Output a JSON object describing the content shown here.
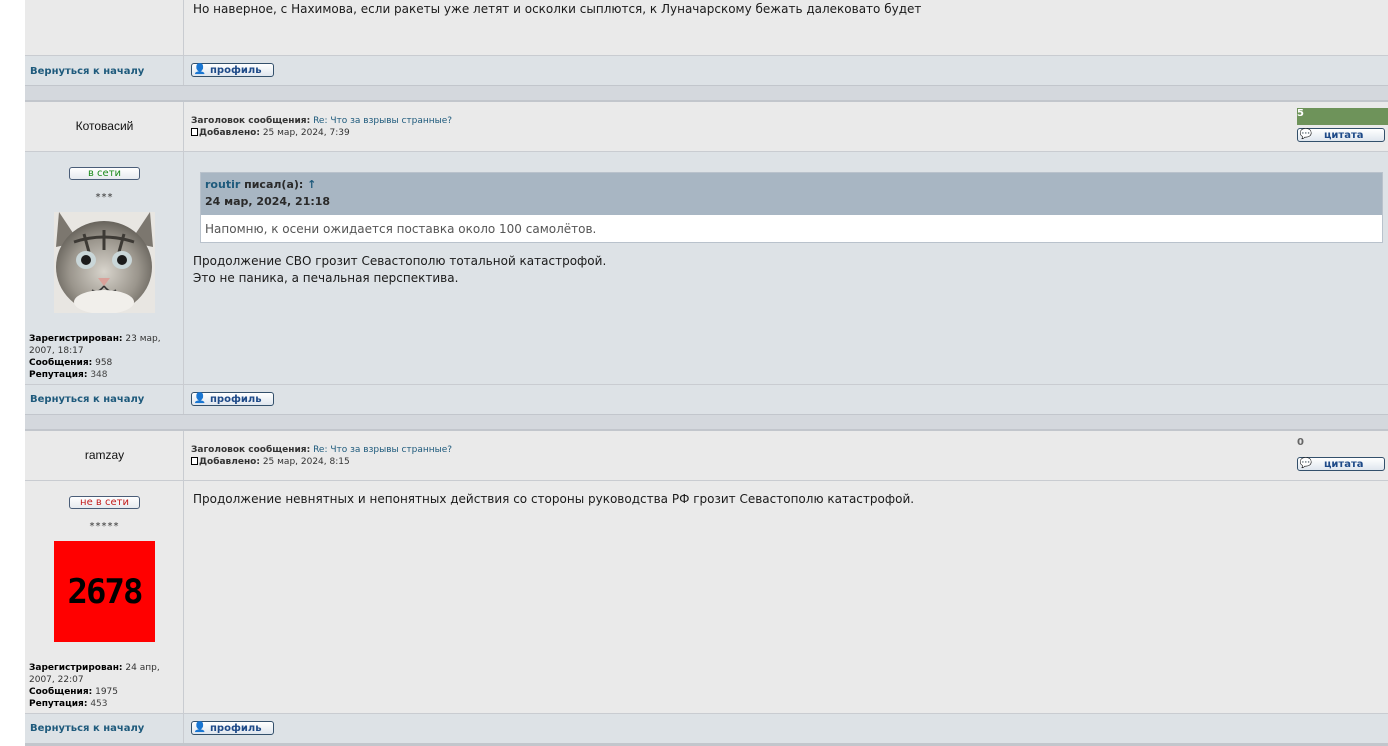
{
  "top_post": {
    "text": "Но наверное, с Нахимова, если ракеты уже летят и осколки сыплются, к Луначарскому бежать далековато будет",
    "back_to_top": "Вернуться к началу",
    "profile_label": "профиль"
  },
  "post1": {
    "username": "Котовасий",
    "subject_label": "Заголовок сообщения:",
    "subject": "Re: Что за взрывы странные?",
    "added_label": "Добавлено:",
    "added": "25 мар, 2024, 7:39",
    "rating": "5",
    "quote_button": "цитата",
    "status": "в сети",
    "rank": "***",
    "avatar": "cat-photo",
    "registered_label": "Зарегистрирован:",
    "registered": "23 мар, 2007, 18:17",
    "messages_label": "Сообщения:",
    "messages": "958",
    "reputation_label": "Репутация:",
    "reputation": "348",
    "quote": {
      "author": "routir",
      "wrote": "писал(а):",
      "arrow": "↑",
      "date": "24 мар, 2024, 21:18",
      "text": "Напомню, к осени ожидается поставка около 100 самолётов."
    },
    "text_line1": "Продолжение СВО грозит Севастополю тотальной катастрофой.",
    "text_line2": "Это не паника, а печальная перспектива.",
    "back_to_top": "Вернуться к началу",
    "profile_label": "профиль"
  },
  "post2": {
    "username": "ramzay",
    "subject_label": "Заголовок сообщения:",
    "subject": "Re: Что за взрывы странные?",
    "added_label": "Добавлено:",
    "added": "25 мар, 2024, 8:15",
    "rating": "0",
    "quote_button": "цитата",
    "status": "не в сети",
    "rank": "*****",
    "avatar_text": "2678",
    "registered_label": "Зарегистрирован:",
    "registered": "24 апр, 2007, 22:07",
    "messages_label": "Сообщения:",
    "messages": "1975",
    "reputation_label": "Репутация:",
    "reputation": "453",
    "text_line1": "Продолжение невнятных и непонятных действия со стороны руководства РФ грозит Севастополю катастрофой.",
    "back_to_top": "Вернуться к началу",
    "profile_label": "профиль"
  },
  "colors": {
    "link": "#1e5a7c",
    "online": "#1a8a1a",
    "offline": "#c21a1a",
    "rating_bar": "#6e935a",
    "avatar_red": "#ff0000"
  }
}
